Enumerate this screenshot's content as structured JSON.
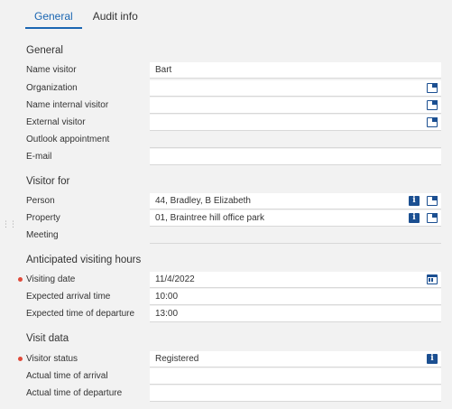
{
  "tabs": [
    {
      "label": "General",
      "active": true
    },
    {
      "label": "Audit info",
      "active": false
    }
  ],
  "sections": {
    "general": "General",
    "visitor_for": "Visitor for",
    "anticipated": "Anticipated visiting hours",
    "visit_data": "Visit data"
  },
  "fields": {
    "name_visitor": {
      "label": "Name visitor",
      "value": "Bart"
    },
    "organization": {
      "label": "Organization",
      "value": ""
    },
    "name_internal_visitor": {
      "label": "Name internal visitor",
      "value": ""
    },
    "external_visitor": {
      "label": "External visitor",
      "value": ""
    },
    "outlook_appointment": {
      "label": "Outlook appointment",
      "value": ""
    },
    "email": {
      "label": "E-mail",
      "value": ""
    },
    "person": {
      "label": "Person",
      "value": "44, Bradley, B Elizabeth"
    },
    "property": {
      "label": "Property",
      "value": "01, Braintree hill office park"
    },
    "meeting": {
      "label": "Meeting",
      "value": ""
    },
    "visiting_date": {
      "label": "Visiting date",
      "value": "11/4/2022",
      "required": true
    },
    "expected_arrival": {
      "label": "Expected arrival time",
      "value": "10:00"
    },
    "expected_departure": {
      "label": "Expected time of departure",
      "value": "13:00"
    },
    "visitor_status": {
      "label": "Visitor status",
      "value": "Registered",
      "required": true
    },
    "actual_arrival": {
      "label": "Actual time of arrival",
      "value": ""
    },
    "actual_departure": {
      "label": "Actual time of departure",
      "value": ""
    }
  },
  "icons": {
    "open_record": "open-record-icon",
    "info": "info-icon",
    "calendar": "calendar-icon"
  },
  "colors": {
    "accent": "#1a66b2",
    "icon": "#1b4f91",
    "required": "#e04a3a",
    "background": "#f2f2f2"
  }
}
